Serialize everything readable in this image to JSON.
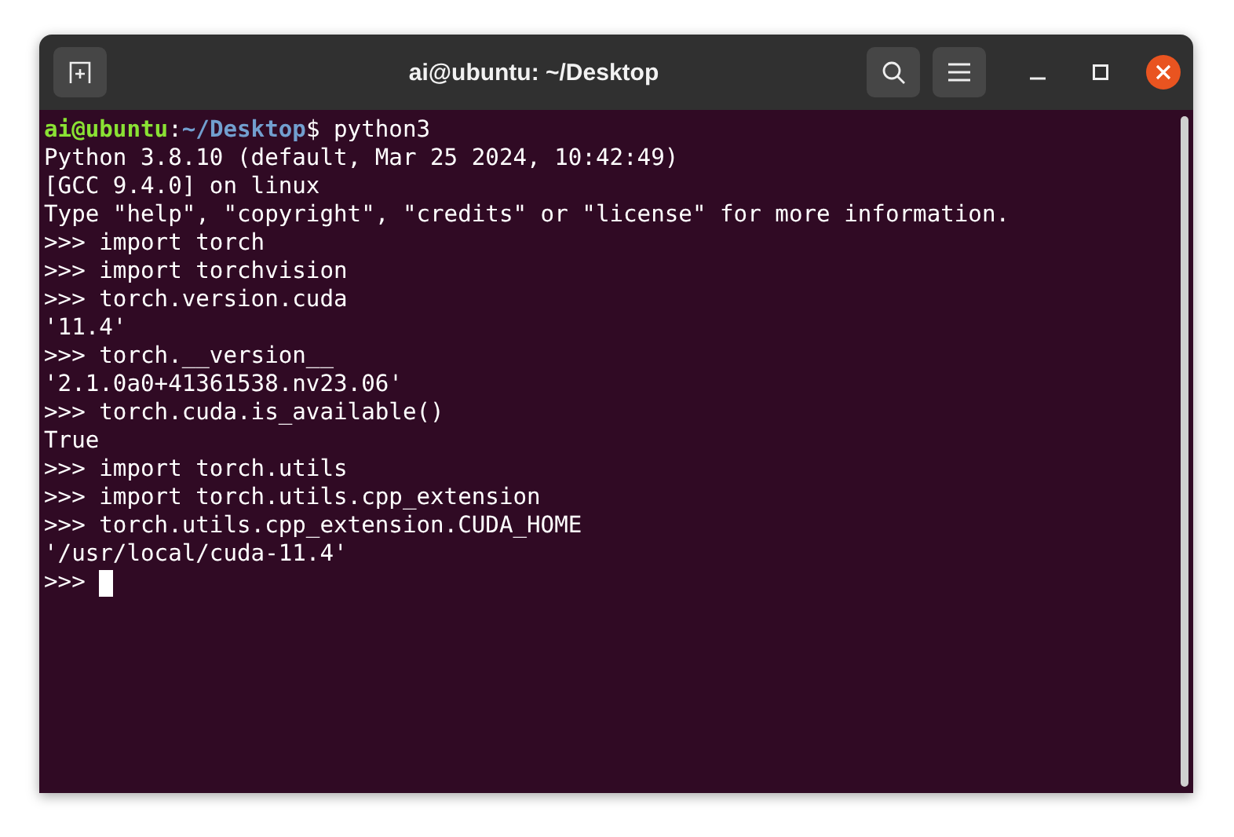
{
  "window": {
    "title": "ai@ubuntu: ~/Desktop"
  },
  "terminal": {
    "prompt": {
      "user_host": "ai@ubuntu",
      "separator": ":",
      "path": "~/Desktop",
      "symbol": "$",
      "command": "python3"
    },
    "lines": [
      "Python 3.8.10 (default, Mar 25 2024, 10:42:49)",
      "[GCC 9.4.0] on linux",
      "Type \"help\", \"copyright\", \"credits\" or \"license\" for more information.",
      ">>> import torch",
      ">>> import torchvision",
      ">>> torch.version.cuda",
      "'11.4'",
      ">>> torch.__version__",
      "'2.1.0a0+41361538.nv23.06'",
      ">>> torch.cuda.is_available()",
      "True",
      ">>> import torch.utils",
      ">>> import torch.utils.cpp_extension",
      ">>> torch.utils.cpp_extension.CUDA_HOME",
      "'/usr/local/cuda-11.4'"
    ],
    "input_line": {
      "text": ">>>",
      "cursor": true
    }
  }
}
